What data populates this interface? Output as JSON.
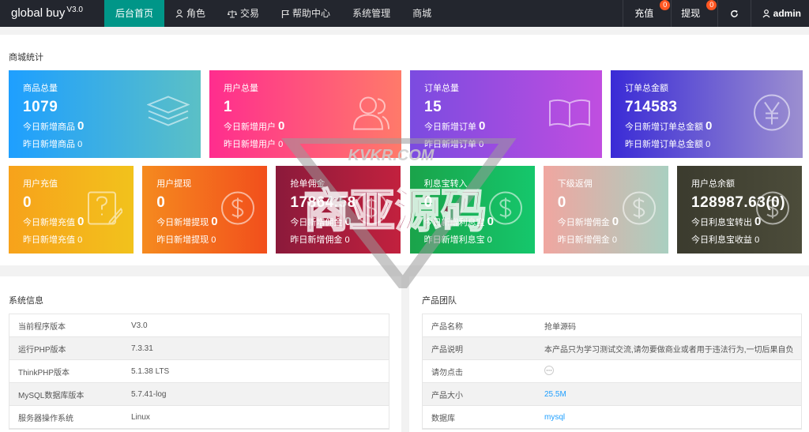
{
  "brand": {
    "name": "global buy",
    "version": "V3.0"
  },
  "nav": [
    {
      "label": "后台首页",
      "icon": "",
      "active": true
    },
    {
      "label": "角色",
      "icon": "user-icon"
    },
    {
      "label": "交易",
      "icon": "scale-icon"
    },
    {
      "label": "帮助中心",
      "icon": "flag-icon"
    },
    {
      "label": "系统管理",
      "icon": ""
    },
    {
      "label": "商城",
      "icon": ""
    }
  ],
  "right_nav": {
    "recharge": {
      "label": "充值",
      "badge": "0"
    },
    "withdraw": {
      "label": "提现",
      "badge": "0"
    },
    "refresh_icon": "refresh-icon",
    "user": {
      "label": "admin",
      "icon": "user-icon"
    }
  },
  "stats": {
    "title": "商城统计",
    "row1": [
      {
        "label": "商品总量",
        "value": "1079",
        "sub1": "今日新增商品",
        "sub1_val": "0",
        "sub2": "昨日新增商品",
        "sub2_val": "0",
        "icon": "layers-icon",
        "colors": [
          "#1e9fff",
          "#5bc0c6"
        ]
      },
      {
        "label": "用户总量",
        "value": "1",
        "sub1": "今日新增用户",
        "sub1_val": "0",
        "sub2": "昨日新增用户",
        "sub2_val": "0",
        "icon": "users-icon",
        "colors": [
          "#ff2d8e",
          "#ff7a6a"
        ]
      },
      {
        "label": "订单总量",
        "value": "15",
        "sub1": "今日新增订单",
        "sub1_val": "0",
        "sub2": "昨日新增订单",
        "sub2_val": "0",
        "icon": "book-icon",
        "colors": [
          "#7b4be0",
          "#c04ee0"
        ]
      },
      {
        "label": "订单总金额",
        "value": "714583",
        "sub1": "今日新增订单总金额",
        "sub1_val": "0",
        "sub2": "昨日新增订单总金额",
        "sub2_val": "0",
        "icon": "yen-icon",
        "colors": [
          "#3a2bd6",
          "#9c8fd0"
        ]
      }
    ],
    "row2": [
      {
        "label": "用户充值",
        "value": "0",
        "sub1": "今日新增充值",
        "sub1_val": "0",
        "sub2": "昨日新增充值",
        "sub2_val": "0",
        "icon": "edit-icon",
        "colors": [
          "#f7a21b",
          "#f2c21c"
        ]
      },
      {
        "label": "用户提现",
        "value": "0",
        "sub1": "今日新增提现",
        "sub1_val": "0",
        "sub2": "昨日新增提现",
        "sub2_val": "0",
        "icon": "dollar-icon",
        "colors": [
          "#f58a1f",
          "#f24f1c"
        ]
      },
      {
        "label": "抢单佣金",
        "value": "17864.58",
        "sub1": "今日新增佣金",
        "sub1_val": "0",
        "sub2": "昨日新增佣金",
        "sub2_val": "0",
        "icon": "dollar-icon",
        "colors": [
          "#8b1a3b",
          "#c2213e"
        ]
      },
      {
        "label": "利息宝转入",
        "value": "0",
        "sub1": "今日新增利息宝",
        "sub1_val": "0",
        "sub2": "昨日新增利息宝",
        "sub2_val": "0",
        "icon": "dollar-icon",
        "colors": [
          "#1aa34a",
          "#15c76c"
        ]
      },
      {
        "label": "下级返佣",
        "value": "0",
        "sub1": "今日新增佣金",
        "sub1_val": "0",
        "sub2": "昨日新增佣金",
        "sub2_val": "0",
        "icon": "dollar-icon",
        "colors": [
          "#f0a6a0",
          "#a9cfc0"
        ]
      },
      {
        "label": "用户总余额",
        "value": "128987.63(0)",
        "sub1": "今日利息宝转出",
        "sub1_val": "0",
        "sub2": "今日利息宝收益",
        "sub2_val": "0",
        "icon": "dollar-icon",
        "colors": [
          "#3b3b2e",
          "#4c4c3a"
        ]
      }
    ]
  },
  "sysinfo": {
    "title": "系统信息",
    "rows": [
      {
        "k": "当前程序版本",
        "v": "V3.0"
      },
      {
        "k": "运行PHP版本",
        "v": "7.3.31"
      },
      {
        "k": "ThinkPHP版本",
        "v": "5.1.38 LTS"
      },
      {
        "k": "MySQL数据库版本",
        "v": "5.7.41-log"
      },
      {
        "k": "服务器操作系统",
        "v": "Linux"
      }
    ]
  },
  "team": {
    "title": "产品团队",
    "rows": [
      {
        "k": "产品名称",
        "v": "抢单源码"
      },
      {
        "k": "产品说明",
        "v": "本产品只为学习测试交流,请勿要做商业或者用于违法行为,一切后果自负"
      },
      {
        "k": "请勿点击",
        "v": ""
      },
      {
        "k": "产品大小",
        "v": "25.5M",
        "link": true
      },
      {
        "k": "数据库",
        "v": "mysql",
        "link": true
      }
    ]
  },
  "watermark": {
    "text": "KVKR.COM",
    "brand": "商亚源码"
  }
}
